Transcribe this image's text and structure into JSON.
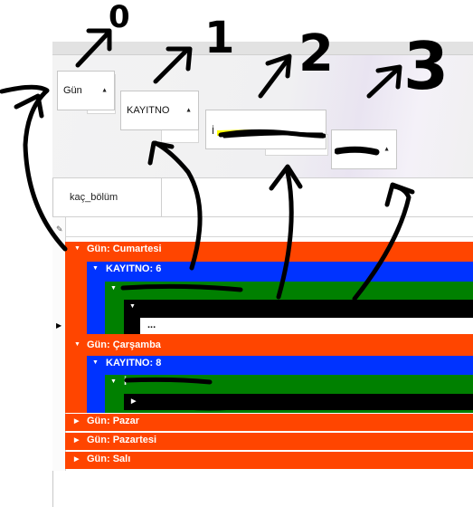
{
  "annotations": {
    "zero": "0",
    "one": "1",
    "two": "2",
    "three": "3"
  },
  "group_panel": {
    "chip1": "Gün",
    "chip2": "KAYITNO",
    "chip3": "İ",
    "chip4": ""
  },
  "column_header": "kaç_bölüm",
  "colors": {
    "orange": "#ff4500",
    "blue": "#0033ff",
    "green": "#008000",
    "black": "#000000"
  },
  "grid": {
    "group_cumartesi": "Gün: Cumartesi",
    "kayitno_6": "KAYITNO: 6",
    "sub_6_green": "",
    "sub_6_black": "",
    "cell_ellipsis": "...",
    "group_carsamba": "Gün: Çarşamba",
    "kayitno_8": "KAYITNO: 8",
    "sub_8_green": "İ",
    "sub_8_black": "",
    "group_pazar": "Gün: Pazar",
    "group_pazartesi": "Gün: Pazartesi",
    "group_sali": "Gün: Salı"
  }
}
